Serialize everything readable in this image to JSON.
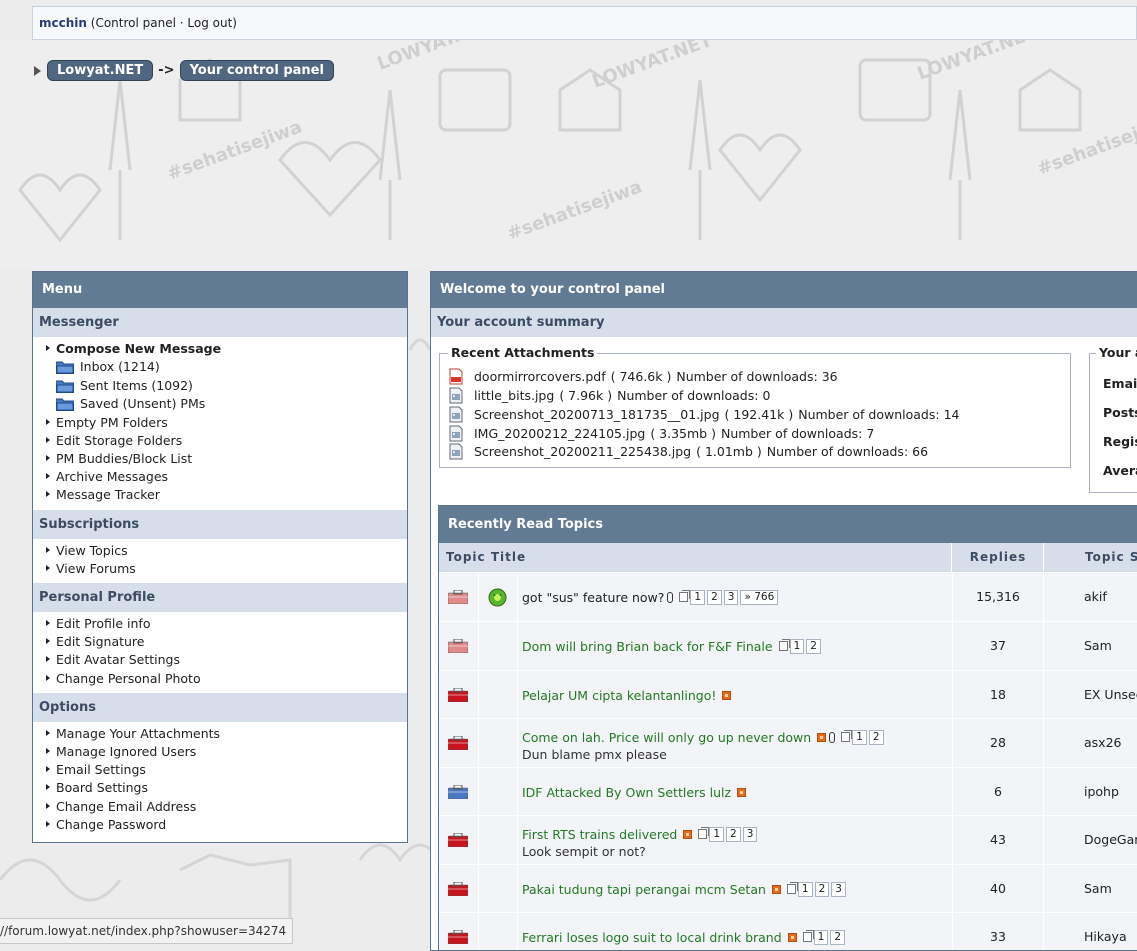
{
  "topbar": {
    "username": "mcchin",
    "links_text": "(Control panel · Log out)"
  },
  "breadcrumb": {
    "items": [
      "Lowyat.NET",
      "Your control panel"
    ],
    "separator": "->"
  },
  "menu": {
    "title": "Menu",
    "messenger": {
      "title": "Messenger",
      "compose": "Compose New Message",
      "folders": [
        "Inbox (1214)",
        "Sent Items (1092)",
        "Saved (Unsent) PMs"
      ],
      "items": [
        "Empty PM Folders",
        "Edit Storage Folders",
        "PM Buddies/Block List",
        "Archive Messages",
        "Message Tracker"
      ]
    },
    "subscriptions": {
      "title": "Subscriptions",
      "items": [
        "View Topics",
        "View Forums"
      ]
    },
    "personal_profile": {
      "title": "Personal Profile",
      "items": [
        "Edit Profile info",
        "Edit Signature",
        "Edit Avatar Settings",
        "Change Personal Photo"
      ]
    },
    "options": {
      "title": "Options",
      "items": [
        "Manage Your Attachments",
        "Manage Ignored Users",
        "Email Settings",
        "Board Settings",
        "Change Email Address",
        "Change Password"
      ]
    }
  },
  "main": {
    "title": "Welcome to your control panel",
    "subtitle": "Your account summary",
    "attachments": {
      "legend": "Recent Attachments",
      "items": [
        {
          "name": "doormirrorcovers.pdf",
          "size": "( 746.6k )",
          "downloads": "Number of downloads: 36",
          "icon": "pdf-icon"
        },
        {
          "name": "little_bits.jpg",
          "size": "( 7.96k )",
          "downloads": "Number of downloads: 0",
          "icon": "image-icon"
        },
        {
          "name": "Screenshot_20200713_181735__01.jpg",
          "size": "( 192.41k )",
          "downloads": "Number of downloads: 14",
          "icon": "image-icon"
        },
        {
          "name": "IMG_20200212_224105.jpg",
          "size": "( 3.35mb )",
          "downloads": "Number of downloads: 7",
          "icon": "image-icon"
        },
        {
          "name": "Screenshot_20200211_225438.jpg",
          "size": "( 1.01mb )",
          "downloads": "Number of downloads: 66",
          "icon": "image-icon"
        }
      ]
    },
    "summary": {
      "legend": "Your a",
      "rows": [
        "Email",
        "Posts",
        "Regis",
        "Avera"
      ]
    },
    "recent_topics": {
      "title": "Recently Read Topics",
      "headers": [
        "Topic Title",
        "Replies",
        "Topic S"
      ],
      "rows": [
        {
          "title": "got \"sus\" feature now?",
          "title_style": "dark",
          "desc": "",
          "replies": "15,316",
          "starter": "akif",
          "folder": "pink",
          "emoji": true,
          "hot": false,
          "clip": true,
          "pages": [
            "1",
            "2",
            "3",
            "» 766"
          ]
        },
        {
          "title": "Dom will bring Brian back for F&F Finale",
          "title_style": "green",
          "desc": "",
          "replies": "37",
          "starter": "Sam",
          "folder": "pink",
          "emoji": false,
          "hot": false,
          "clip": false,
          "pages": [
            "1",
            "2"
          ]
        },
        {
          "title": "Pelajar UM cipta kelantanlingo!",
          "title_style": "green",
          "desc": "",
          "replies": "18",
          "starter": "EX Unseen",
          "folder": "red",
          "emoji": false,
          "hot": true,
          "clip": false,
          "pages": []
        },
        {
          "title": "Come on lah. Price will only go up never down",
          "title_style": "green",
          "desc": "Dun blame pmx please",
          "replies": "28",
          "starter": "asx26",
          "folder": "red",
          "emoji": false,
          "hot": true,
          "clip": true,
          "pages": [
            "1",
            "2"
          ]
        },
        {
          "title": "IDF Attacked By Own Settlers lulz",
          "title_style": "green",
          "desc": "",
          "replies": "6",
          "starter": "ipohp",
          "folder": "blue",
          "emoji": false,
          "hot": true,
          "clip": false,
          "pages": []
        },
        {
          "title": "First RTS trains delivered",
          "title_style": "green",
          "desc": "Look sempit or not?",
          "replies": "43",
          "starter": "DogeGam",
          "folder": "red",
          "emoji": false,
          "hot": true,
          "clip": false,
          "pages": [
            "1",
            "2",
            "3"
          ]
        },
        {
          "title": "Pakai tudung tapi perangai mcm Setan",
          "title_style": "green",
          "desc": "",
          "replies": "40",
          "starter": "Sam",
          "folder": "red",
          "emoji": false,
          "hot": true,
          "clip": false,
          "pages": [
            "1",
            "2",
            "3"
          ]
        },
        {
          "title": "Ferrari loses logo suit to local drink brand",
          "title_style": "green",
          "desc": "",
          "replies": "33",
          "starter": "Hikaya",
          "folder": "red",
          "emoji": false,
          "hot": true,
          "clip": false,
          "pages": [
            "1",
            "2"
          ]
        }
      ]
    }
  },
  "statusbar": {
    "url": "//forum.lowyat.net/index.php?showuser=34274"
  },
  "colors": {
    "header_bg": "#617b95",
    "section_bg": "#d6dfe9",
    "topic_green": "#237a23",
    "hot_orange": "#e46c1f",
    "folder_red": "#c8141e",
    "folder_pink": "#e08a8a",
    "folder_blue": "#4a79c4"
  }
}
